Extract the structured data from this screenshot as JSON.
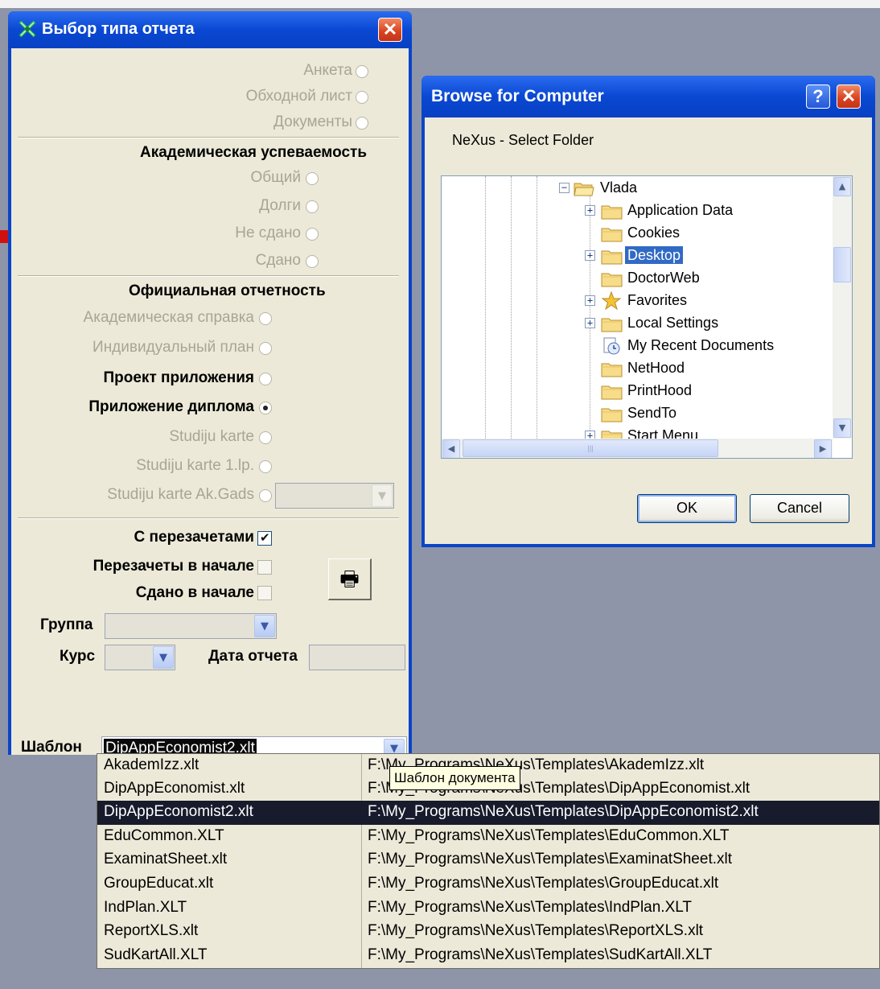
{
  "report_window": {
    "title": "Выбор типа отчета",
    "close_glyph": "✕",
    "top_options": [
      {
        "label": "Анкета",
        "checked": false,
        "enabled": false
      },
      {
        "label": "Обходной лист",
        "checked": false,
        "enabled": false
      },
      {
        "label": "Документы",
        "checked": false,
        "enabled": false
      }
    ],
    "academic": {
      "heading": "Академическая успеваемость",
      "options": [
        {
          "label": "Общий",
          "checked": false,
          "enabled": false
        },
        {
          "label": "Долги",
          "checked": false,
          "enabled": false
        },
        {
          "label": "Не сдано",
          "checked": false,
          "enabled": false
        },
        {
          "label": "Сдано",
          "checked": false,
          "enabled": false
        }
      ]
    },
    "official": {
      "heading": "Официальная отчетность",
      "options": [
        {
          "label": "Академическая справка",
          "checked": false,
          "enabled": false
        },
        {
          "label": "Индивидуальный план",
          "checked": false,
          "enabled": false
        },
        {
          "label": "Проект приложения",
          "checked": false,
          "enabled": true
        },
        {
          "label": "Приложение диплома",
          "checked": true,
          "enabled": true
        },
        {
          "label": "Studiju karte",
          "checked": false,
          "enabled": false
        },
        {
          "label": "Studiju karte 1.lp.",
          "checked": false,
          "enabled": false
        },
        {
          "label": "Studiju karte Ak.Gads",
          "checked": false,
          "enabled": false
        }
      ]
    },
    "checkboxes": [
      {
        "label": "С перезачетами",
        "checked": true
      },
      {
        "label": "Перезачеты в начале",
        "checked": false
      },
      {
        "label": "Сдано в начале",
        "checked": false
      }
    ],
    "print_icon": "🖶",
    "group_label": "Группа",
    "group_value": "",
    "course_label": "Курс",
    "course_value": "",
    "report_date_label": "Дата отчета",
    "report_date_value": "",
    "template_label": "Шаблон",
    "template_value": "DipAppEconomist2.xlt",
    "dropdown_arrow": "❯"
  },
  "template_dropdown": {
    "tooltip": "Шаблон документа",
    "selected_index": 2,
    "items": [
      {
        "name": "AkademIzz.xlt",
        "path": "F:\\My_Programs\\NeXus\\Templates\\AkademIzz.xlt"
      },
      {
        "name": "DipAppEconomist.xlt",
        "path": "F:\\My_Programs\\NeXus\\Templates\\DipAppEconomist.xlt"
      },
      {
        "name": "DipAppEconomist2.xlt",
        "path": "F:\\My_Programs\\NeXus\\Templates\\DipAppEconomist2.xlt"
      },
      {
        "name": "EduCommon.XLT",
        "path": "F:\\My_Programs\\NeXus\\Templates\\EduCommon.XLT"
      },
      {
        "name": "ExaminatSheet.xlt",
        "path": "F:\\My_Programs\\NeXus\\Templates\\ExaminatSheet.xlt"
      },
      {
        "name": "GroupEducat.xlt",
        "path": "F:\\My_Programs\\NeXus\\Templates\\GroupEducat.xlt"
      },
      {
        "name": "IndPlan.XLT",
        "path": "F:\\My_Programs\\NeXus\\Templates\\IndPlan.XLT"
      },
      {
        "name": "ReportXLS.xlt",
        "path": "F:\\My_Programs\\NeXus\\Templates\\ReportXLS.xlt"
      },
      {
        "name": "SudKartAll.XLT",
        "path": "F:\\My_Programs\\NeXus\\Templates\\SudKartAll.XLT"
      }
    ]
  },
  "browse_dialog": {
    "title": "Browse for Computer",
    "help_glyph": "?",
    "close_glyph": "✕",
    "prompt": "NeXus   - Select Folder",
    "tree": [
      {
        "name": "Vlada",
        "expander": "−",
        "icon": "folder-open-icon",
        "selected": false
      },
      {
        "name": "Application Data",
        "expander": "+",
        "icon": "folder-icon",
        "selected": false
      },
      {
        "name": "Cookies",
        "expander": "",
        "icon": "folder-icon",
        "selected": false
      },
      {
        "name": "Desktop",
        "expander": "+",
        "icon": "folder-icon",
        "selected": true
      },
      {
        "name": "DoctorWeb",
        "expander": "",
        "icon": "folder-icon",
        "selected": false
      },
      {
        "name": "Favorites",
        "expander": "+",
        "icon": "star-icon",
        "selected": false
      },
      {
        "name": "Local Settings",
        "expander": "+",
        "icon": "folder-icon",
        "selected": false
      },
      {
        "name": "My Recent Documents",
        "expander": "",
        "icon": "recent-documents-icon",
        "selected": false
      },
      {
        "name": "NetHood",
        "expander": "",
        "icon": "folder-icon",
        "selected": false
      },
      {
        "name": "PrintHood",
        "expander": "",
        "icon": "folder-icon",
        "selected": false
      },
      {
        "name": "SendTo",
        "expander": "",
        "icon": "folder-icon",
        "selected": false
      },
      {
        "name": "Start Menu",
        "expander": "+",
        "icon": "folder-icon",
        "selected": false
      }
    ],
    "scroll_up": "▲",
    "scroll_down": "▼",
    "scroll_left": "◀",
    "scroll_right": "▶",
    "ok_label": "OK",
    "cancel_label": "Cancel"
  }
}
